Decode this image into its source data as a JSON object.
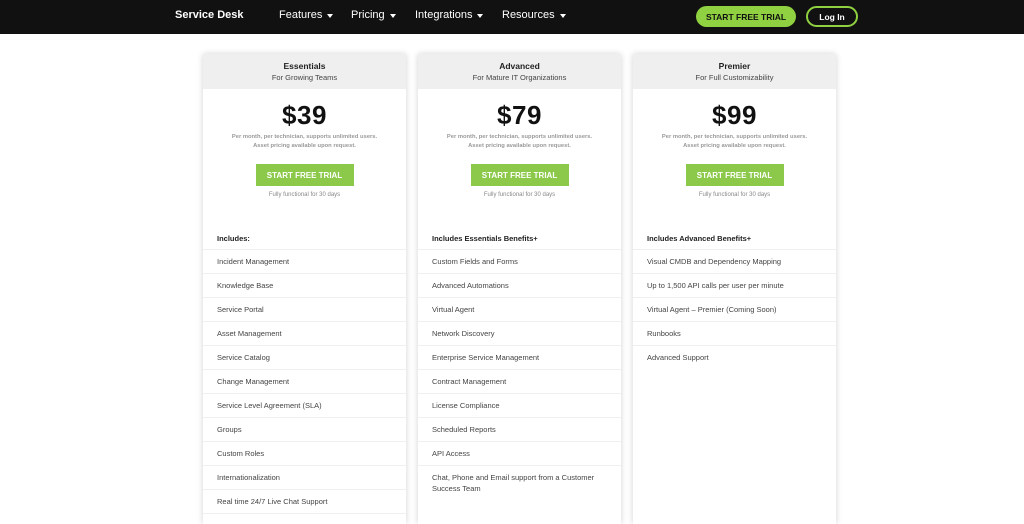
{
  "nav": {
    "brand": "Service Desk",
    "items": [
      {
        "label": "Features"
      },
      {
        "label": "Pricing"
      },
      {
        "label": "Integrations"
      },
      {
        "label": "Resources"
      }
    ],
    "trial_label": "START FREE TRIAL",
    "login_label": "Log In"
  },
  "plans": [
    {
      "name": "Essentials",
      "subtitle": "For Growing Teams",
      "price": "$39",
      "note_line1": "Per month, per technician, supports unlimited users.",
      "note_line2": "Asset pricing available upon request.",
      "button": "START FREE TRIAL",
      "trial_note": "Fully functional for 30 days",
      "features_heading": "Includes:",
      "features": [
        "Incident Management",
        "Knowledge Base",
        "Service Portal",
        "Asset Management",
        "Service Catalog",
        "Change Management",
        "Service Level Agreement (SLA)",
        "Groups",
        "Custom Roles",
        "Internationalization",
        "Real time 24/7 Live Chat Support"
      ]
    },
    {
      "name": "Advanced",
      "subtitle": "For Mature IT Organizations",
      "price": "$79",
      "note_line1": "Per month, per technician, supports unlimited users.",
      "note_line2": "Asset pricing available upon request.",
      "button": "START FREE TRIAL",
      "trial_note": "Fully functional for 30 days",
      "features_heading": "Includes Essentials Benefits+",
      "features": [
        "Custom Fields and Forms",
        "Advanced Automations",
        "Virtual Agent",
        "Network Discovery",
        "Enterprise Service Management",
        "Contract Management",
        "License Compliance",
        "Scheduled Reports",
        "API Access",
        "Chat, Phone and Email support from a Customer Success Team"
      ]
    },
    {
      "name": "Premier",
      "subtitle": "For Full Customizability",
      "price": "$99",
      "note_line1": "Per month, per technician, supports unlimited users.",
      "note_line2": "Asset pricing available upon request.",
      "button": "START FREE TRIAL",
      "trial_note": "Fully functional for 30 days",
      "features_heading": "Includes Advanced Benefits+",
      "features": [
        "Visual CMDB and Dependency Mapping",
        "Up to 1,500 API calls per user per minute",
        "Virtual Agent – Premier (Coming Soon)",
        "Runbooks",
        "Advanced Support"
      ]
    }
  ],
  "colors": {
    "accent": "#8fd140",
    "button": "#8cc94a",
    "nav_bg": "#111111",
    "header_bg": "#efefef"
  }
}
